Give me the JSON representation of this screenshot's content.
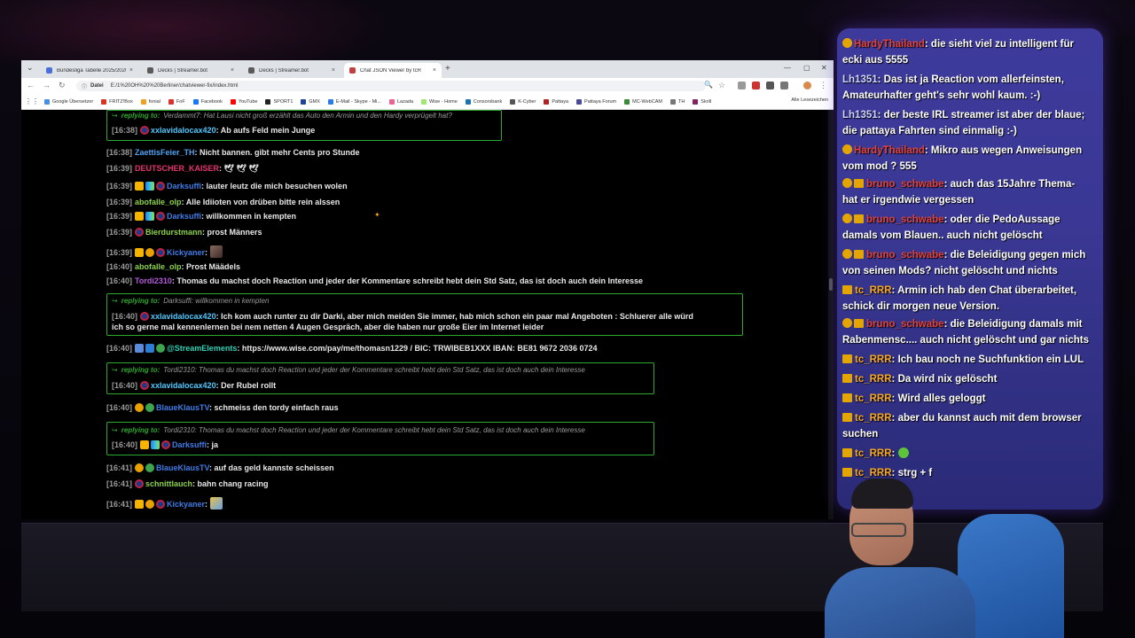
{
  "browser": {
    "tabs": [
      {
        "label": "Bundesliga Tabelle 2025/2026 ...",
        "active": false,
        "icon_color": "#4a6fd8"
      },
      {
        "label": "Decks | Streamer.bot",
        "active": false,
        "icon_color": "#5a5a5a"
      },
      {
        "label": "Decks | Streamer.bot",
        "active": false,
        "icon_color": "#5a5a5a"
      },
      {
        "label": "Chat JSON Viewer by tcR",
        "active": true,
        "icon_color": "#c24040"
      }
    ],
    "url_tag": "Datei",
    "url": "E:/1%20OH%20%20Berliner/chatviewer-fix/index.html",
    "bookmarks": [
      {
        "label": "Google Übersetzer",
        "color": "#4a90e2"
      },
      {
        "label": "FRITZ!Box",
        "color": "#d9341f"
      },
      {
        "label": "fonial",
        "color": "#f0a020"
      },
      {
        "label": "FoF",
        "color": "#d93030"
      },
      {
        "label": "Facebook",
        "color": "#1877f2"
      },
      {
        "label": "YouTube",
        "color": "#ff0000"
      },
      {
        "label": "SPORT1",
        "color": "#222222"
      },
      {
        "label": "GMX",
        "color": "#1c449b"
      },
      {
        "label": "E-Mail - Skype - Mi...",
        "color": "#2a7de1"
      },
      {
        "label": "Lazada",
        "color": "#f06292"
      },
      {
        "label": "Wise - Home",
        "color": "#9fe870"
      },
      {
        "label": "Consorsbank",
        "color": "#1a73b8"
      },
      {
        "label": "K-Cyber",
        "color": "#555555"
      },
      {
        "label": "Pattaya",
        "color": "#b22222"
      },
      {
        "label": "Pattaya Forum",
        "color": "#4a4a9a"
      },
      {
        "label": "MC-WebCAM",
        "color": "#3a8a3a"
      },
      {
        "label": "TH",
        "color": "#777777"
      },
      {
        "label": "Skrill",
        "color": "#862165"
      }
    ],
    "bookmarks_right": "Alle Lesezeichen"
  },
  "chat": {
    "top_reply": {
      "label": "replying to:",
      "text": "Verdammt7: Hat Lausi nicht groß erzählt das Auto den Armin und den Hardy verprügelt hat?",
      "ts": "[16:38]",
      "user": "xxlavidalocax420",
      "message": ": Ab aufs Feld mein Junge"
    },
    "lines": [
      {
        "ts": "[16:38]",
        "user": "ZaettisFeier_TH",
        "message": ": Nicht bannen. gibt mehr Cents pro Stunde"
      },
      {
        "ts": "[16:39]",
        "user": "DEUTSCHER_KAISER",
        "message": ": 🕊 🕊 🕊"
      },
      {
        "ts": "[16:39]",
        "user": "Darksuffi",
        "message": ": lauter leutz die mich besuchen wolen"
      },
      {
        "ts": "[16:39]",
        "user": "abofalle_olp",
        "message": ": Alle Idiioten von drüben bitte rein alssen"
      },
      {
        "ts": "[16:39]",
        "user": "Darksuffi",
        "message": ": willkommen in kempten"
      },
      {
        "ts": "[16:39]",
        "user": "Bierdurstmann",
        "message": ": prost Männers"
      },
      {
        "ts": "[16:39]",
        "user": "Kickyaner",
        "message": ":"
      },
      {
        "ts": "[16:40]",
        "user": "abofalle_olp",
        "message": ": Prost Määdels"
      },
      {
        "ts": "[16:40]",
        "user": "Tordi2310",
        "message": ": Thomas du machst doch Reaction und jeder der Kommentare schreibt hebt dein Std Satz, das ist doch auch dein Interesse"
      }
    ],
    "reply_darksuffi": {
      "label": "replying to:",
      "text": "Darksuffi: willkommen in kempten",
      "ts": "[16:40]",
      "user": "xxlavidalocax420",
      "message": ": Ich kom auch runter zu dir Darki, aber mich meiden Sie immer, hab mich schon ein paar mal Angeboten : Schluerer alle würd",
      "message2": "ich so gerne mal kennenlernen bei nem netten 4 Augen Gespräch, aber die haben nur große Eier im Internet leider"
    },
    "streamelements": {
      "ts": "[16:40]",
      "user": "@StreamElements",
      "message": ": https://www.wise.com/pay/me/thomasn1229 / BIC: TRWIBEB1XXX IBAN: BE81 9672 2036 0724"
    },
    "reply_tordi_1": {
      "label": "replying to:",
      "text": "Tordi2310: Thomas du machst doch Reaction und jeder der Kommentare schreibt hebt dein Std Satz, das ist doch auch dein Interesse",
      "ts": "[16:40]",
      "user": "xxlavidalocax420",
      "message": ": Der Rubel rollt"
    },
    "blaueklaus_1": {
      "ts": "[16:40]",
      "user": "BlaueKlausTV",
      "message": ": schmeiss den tordy einfach raus"
    },
    "reply_tordi_2": {
      "label": "replying to:",
      "text": "Tordi2310: Thomas du machst doch Reaction und jeder der Kommentare schreibt hebt dein Std Satz, das ist doch auch dein Interesse",
      "ts": "[16:40]",
      "user": "Darksuffi",
      "message": ": ja"
    },
    "bottom_lines": [
      {
        "ts": "[16:41]",
        "user": "BlaueKlausTV",
        "message": ": auf das geld kannste scheissen"
      },
      {
        "ts": "[16:41]",
        "user": "schnittlauch",
        "message": ": bahn chang racing"
      },
      {
        "ts": "[16:41]",
        "user": "Kickyaner",
        "message": ":"
      }
    ]
  },
  "overlay": {
    "messages": [
      {
        "user": "HardyThailand",
        "text": ": die sieht viel zu intelligent für ecki aus 5555",
        "badges": "sub"
      },
      {
        "user": "Lh1351",
        "text": ": Das ist ja Reaction vom allerfeinsten, Amateurhafter geht's sehr wohl kaum. :-)",
        "badges": ""
      },
      {
        "user": "Lh1351",
        "text": ": der beste IRL streamer ist aber der blaue; die pattaya Fahrten sind einmalig :-)",
        "badges": ""
      },
      {
        "user": "HardyThailand",
        "text": ": Mikro aus wegen Anweisungen vom mod ? 555",
        "badges": "sub"
      },
      {
        "user": "bruno_schwabe",
        "text": ": auch das 15Jahre Thema- hat er irgendwie vergessen",
        "badges": "sub-crown"
      },
      {
        "user": "bruno_schwabe",
        "text": ": oder die PedoAussage damals vom Blauen.. auch nicht gelöscht",
        "badges": "sub-crown"
      },
      {
        "user": "bruno_schwabe",
        "text": ": die Beleidigung gegen mich von seinen Mods? nicht gelöscht und nichts",
        "badges": "sub-crown"
      },
      {
        "user": "tc_RRR",
        "text": ": Armin ich hab den Chat überarbeitet, schick dir morgen neue Version.",
        "badges": "crown"
      },
      {
        "user": "bruno_schwabe",
        "text": ": die Beleidigung damals mit Rabenmensc.... auch nicht gelöscht und gar nichts",
        "badges": "sub-crown"
      },
      {
        "user": "tc_RRR",
        "text": ": Ich bau noch ne Suchfunktion ein LUL",
        "badges": "crown"
      },
      {
        "user": "tc_RRR",
        "text": ": Da wird nix gelöscht",
        "badges": "crown"
      },
      {
        "user": "tc_RRR",
        "text": ": Wird alles geloggt",
        "badges": "crown"
      },
      {
        "user": "tc_RRR",
        "text": ": aber du kannst auch mit dem browser suchen",
        "badges": "crown"
      },
      {
        "user": "tc_RRR",
        "text": ":",
        "badges": "crown"
      },
      {
        "user": "tc_RRR",
        "text": ": strg + f",
        "badges": "crown"
      }
    ]
  },
  "colors": {
    "reply_green": "#2ea82e",
    "overlay_bg": "#3a3894",
    "timestamp": "#9a9a9a",
    "tc_RRR": "#f5a623",
    "bruno": "#e0433b",
    "hardy": "#e0433b",
    "lh1351": "#cfd3ff"
  }
}
